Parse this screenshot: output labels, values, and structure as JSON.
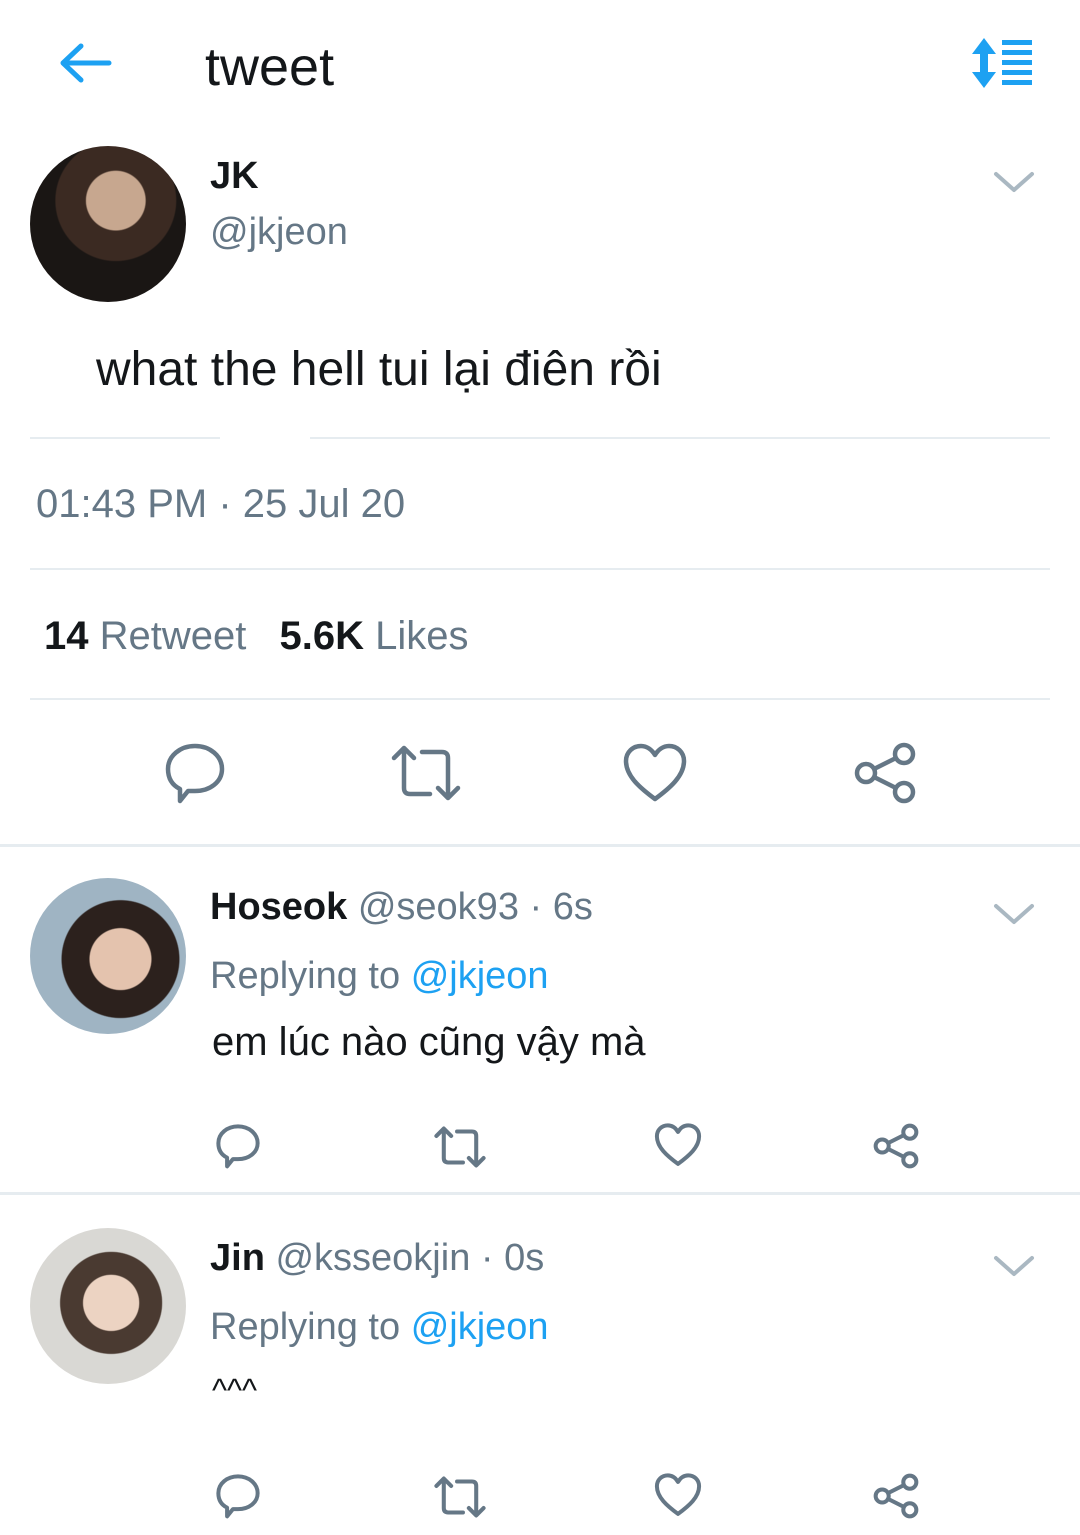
{
  "header": {
    "title": "tweet",
    "back_icon": "arrow-left-icon",
    "sort_icon": "sort-list-icon",
    "accent_color": "#1da1f2"
  },
  "main_tweet": {
    "name": "JK",
    "handle": "@jkjeon",
    "text": "what the hell tui lại điên rồi",
    "timestamp": "01:43 PM · 25 Jul 20",
    "retweet_count": "14",
    "retweet_label": "Retweet",
    "like_count": "5.6K",
    "like_label": "Likes",
    "actions": [
      "reply-icon",
      "retweet-icon",
      "like-icon",
      "share-icon"
    ]
  },
  "replies": [
    {
      "name": "Hoseok",
      "meta": "@seok93 · 6s",
      "replying_prefix": "Replying to",
      "replying_to": "@jkjeon",
      "text": "em lúc nào cũng vậy mà"
    },
    {
      "name": "Jin",
      "meta": "@ksseokjin · 0s",
      "replying_prefix": "Replying to",
      "replying_to": "@jkjeon",
      "text": "^^^"
    }
  ]
}
